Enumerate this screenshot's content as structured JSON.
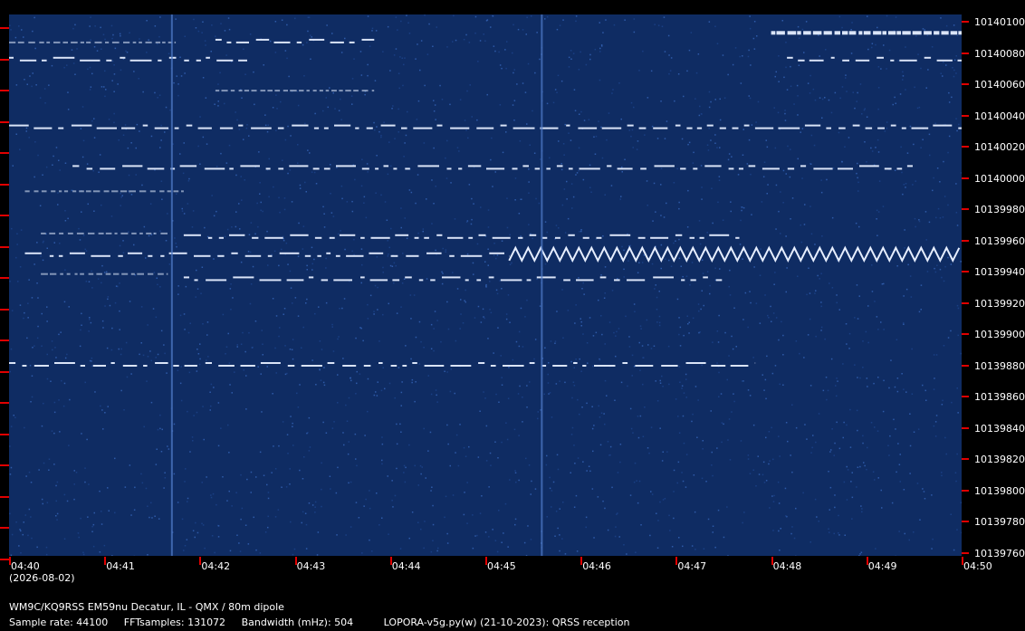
{
  "station": "WM9C/KQ9RSS EM59nu Decatur, IL - QMX / 80m dipole",
  "date": "(2026-08-02)",
  "footer": {
    "sample_rate": "Sample rate: 44100",
    "fft_samples": "FFTsamples: 131072",
    "bandwidth": "Bandwidth (mHz): 504",
    "software": "LOPORA-v5g.py(w) (21-10-2023): QRSS reception"
  },
  "frequency_labels": [
    "10140100",
    "10140080",
    "10140060",
    "10140040",
    "10140020",
    "10140000",
    "10139980",
    "10139960",
    "10139940",
    "10139920",
    "10139900",
    "10139880",
    "10139860",
    "10139840",
    "10139820",
    "10139800",
    "10139780",
    "10139760"
  ],
  "time_labels": [
    "04:40",
    "04:41",
    "04:42",
    "04:43",
    "04:44",
    "04:45",
    "04:46",
    "04:47",
    "04:48",
    "04:49",
    "04:50"
  ],
  "colors": {
    "background": "#0f2c63",
    "trace": "#e6eeff",
    "tick": "#e00000"
  },
  "chart_data": {
    "type": "heatmap",
    "x_unit": "UTC time",
    "y_unit": "Hz",
    "xlim": [
      "04:40",
      "04:50"
    ],
    "ylim": [
      10139750,
      10140110
    ],
    "signals": [
      {
        "freq": 10140099,
        "t_start": "04:48",
        "t_end": "04:50",
        "pattern": "dense"
      },
      {
        "freq": 10140092,
        "t_start": "04:40",
        "t_end": "04:41:45",
        "pattern": "faint"
      },
      {
        "freq": 10140092,
        "t_start": "04:42:10",
        "t_end": "04:43:50",
        "pattern": "dash"
      },
      {
        "freq": 10140080,
        "t_start": "04:40",
        "t_end": "04:42:30",
        "pattern": "dash"
      },
      {
        "freq": 10140080,
        "t_start": "04:48:10",
        "t_end": "04:50",
        "pattern": "dash"
      },
      {
        "freq": 10140060,
        "t_start": "04:42:10",
        "t_end": "04:43:50",
        "pattern": "faint"
      },
      {
        "freq": 10140035,
        "t_start": "04:40",
        "t_end": "04:50",
        "pattern": "dash"
      },
      {
        "freq": 10140008,
        "t_start": "04:40:40",
        "t_end": "04:49:30",
        "pattern": "dash"
      },
      {
        "freq": 10139993,
        "t_start": "04:40:10",
        "t_end": "04:41:50",
        "pattern": "faint"
      },
      {
        "freq": 10139965,
        "t_start": "04:40:20",
        "t_end": "04:41:40",
        "pattern": "faint"
      },
      {
        "freq": 10139962,
        "t_start": "04:41:50",
        "t_end": "04:47:40",
        "pattern": "dash"
      },
      {
        "freq": 10139950,
        "t_start": "04:40:10",
        "t_end": "04:45:15",
        "pattern": "dash"
      },
      {
        "freq": 10139950,
        "t_start": "04:45:15",
        "t_end": "04:50",
        "pattern": "zigzag"
      },
      {
        "freq": 10139938,
        "t_start": "04:40:20",
        "t_end": "04:41:40",
        "pattern": "faint"
      },
      {
        "freq": 10139934,
        "t_start": "04:41:50",
        "t_end": "04:47:30",
        "pattern": "dash"
      },
      {
        "freq": 10139877,
        "t_start": "04:40",
        "t_end": "04:47:50",
        "pattern": "dash"
      },
      {
        "freq": 10140060,
        "t_start": "04:41:42",
        "t_end": "04:41:45",
        "pattern": "vertical_line"
      },
      {
        "freq": 10140060,
        "t_start": "04:45:35",
        "t_end": "04:45:38",
        "pattern": "vertical_line"
      }
    ]
  }
}
